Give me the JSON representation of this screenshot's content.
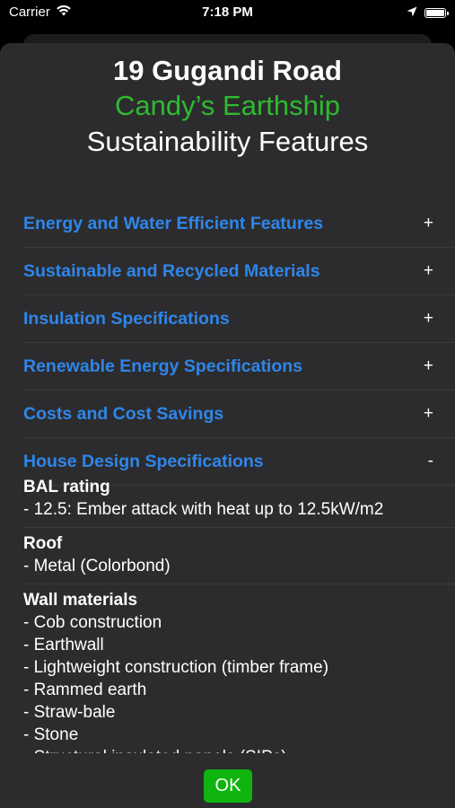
{
  "status_bar": {
    "carrier": "Carrier",
    "time": "7:18 PM"
  },
  "header": {
    "address": "19 Gugandi Road",
    "name": "Candy’s Earthship",
    "section": "Sustainability Features",
    "name_color": "#2ebb2e"
  },
  "accordion": [
    {
      "label": "Energy and Water Efficient Features",
      "toggle": "+"
    },
    {
      "label": "Sustainable and Recycled Materials",
      "toggle": "+"
    },
    {
      "label": "Insulation Specifications",
      "toggle": "+"
    },
    {
      "label": "Renewable Energy Specifications",
      "toggle": "+"
    },
    {
      "label": "Costs and Cost Savings",
      "toggle": "+"
    },
    {
      "label": "House Design Specifications",
      "toggle": "-"
    }
  ],
  "details": [
    {
      "heading": "BAL rating",
      "lines": [
        "- 12.5: Ember attack with heat up to 12.5kW/m2"
      ]
    },
    {
      "heading": "Roof",
      "lines": [
        "- Metal (Colorbond)"
      ]
    },
    {
      "heading": "Wall materials",
      "lines": [
        "- Cob construction",
        "- Earthwall",
        "- Lightweight construction (timber frame)",
        "- Rammed earth",
        "- Straw-bale",
        "- Stone",
        "- Structural insulated panels (SIPs)"
      ]
    }
  ],
  "footer": {
    "ok_label": "OK"
  },
  "colors": {
    "accent_link": "#2f86ea",
    "ok_button": "#0fb40f",
    "sheet_bg": "#2c2c2e"
  }
}
